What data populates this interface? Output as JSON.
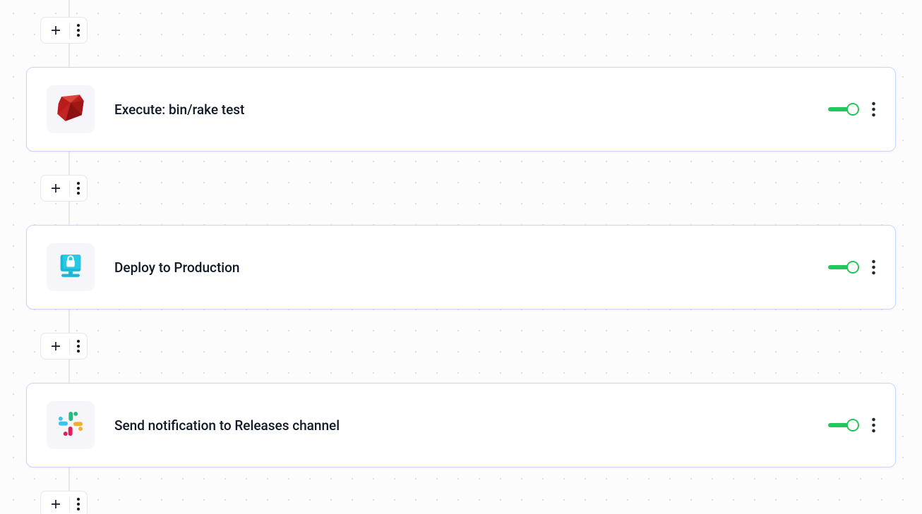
{
  "steps": [
    {
      "label": "Execute: bin/rake test",
      "icon": "ruby",
      "enabled": true
    },
    {
      "label": "Deploy to Production",
      "icon": "deploy",
      "enabled": true
    },
    {
      "label": "Send notification to Releases channel",
      "icon": "slack",
      "enabled": true
    }
  ],
  "colors": {
    "toggle_on": "#22c55e",
    "card_border": "#c7d6ff"
  }
}
